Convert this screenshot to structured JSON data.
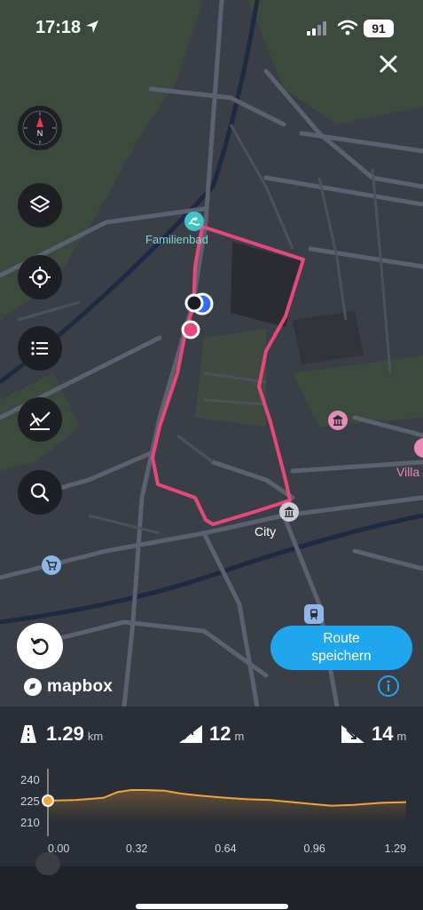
{
  "status": {
    "time": "17:18",
    "battery": "91"
  },
  "map": {
    "labels": {
      "pool": "Familienbad",
      "city": "City",
      "villa": "Villa"
    },
    "save_button": {
      "line1": "Route",
      "line2": "speichern"
    },
    "attribution": "mapbox"
  },
  "stats": {
    "distance": {
      "value": "1.29",
      "unit": "km"
    },
    "ascent": {
      "value": "12",
      "unit": "m"
    },
    "descent": {
      "value": "14",
      "unit": "m"
    }
  },
  "chart_data": {
    "type": "area",
    "y_ticks": [
      "240",
      "225",
      "210"
    ],
    "x_ticks": [
      "0.00",
      "0.32",
      "0.64",
      "0.96",
      "1.29"
    ],
    "ylim": [
      210,
      240
    ],
    "xlim": [
      0,
      1.29
    ],
    "x": [
      0,
      0.1,
      0.2,
      0.25,
      0.3,
      0.35,
      0.42,
      0.48,
      0.55,
      0.64,
      0.72,
      0.8,
      0.88,
      0.96,
      1.02,
      1.1,
      1.2,
      1.29
    ],
    "y": [
      225,
      225.5,
      227,
      231,
      232.5,
      232.5,
      232,
      230,
      228.5,
      227,
      226,
      225.5,
      224,
      222.5,
      221.5,
      222,
      223.5,
      224
    ],
    "accent": "#f2a43a"
  }
}
